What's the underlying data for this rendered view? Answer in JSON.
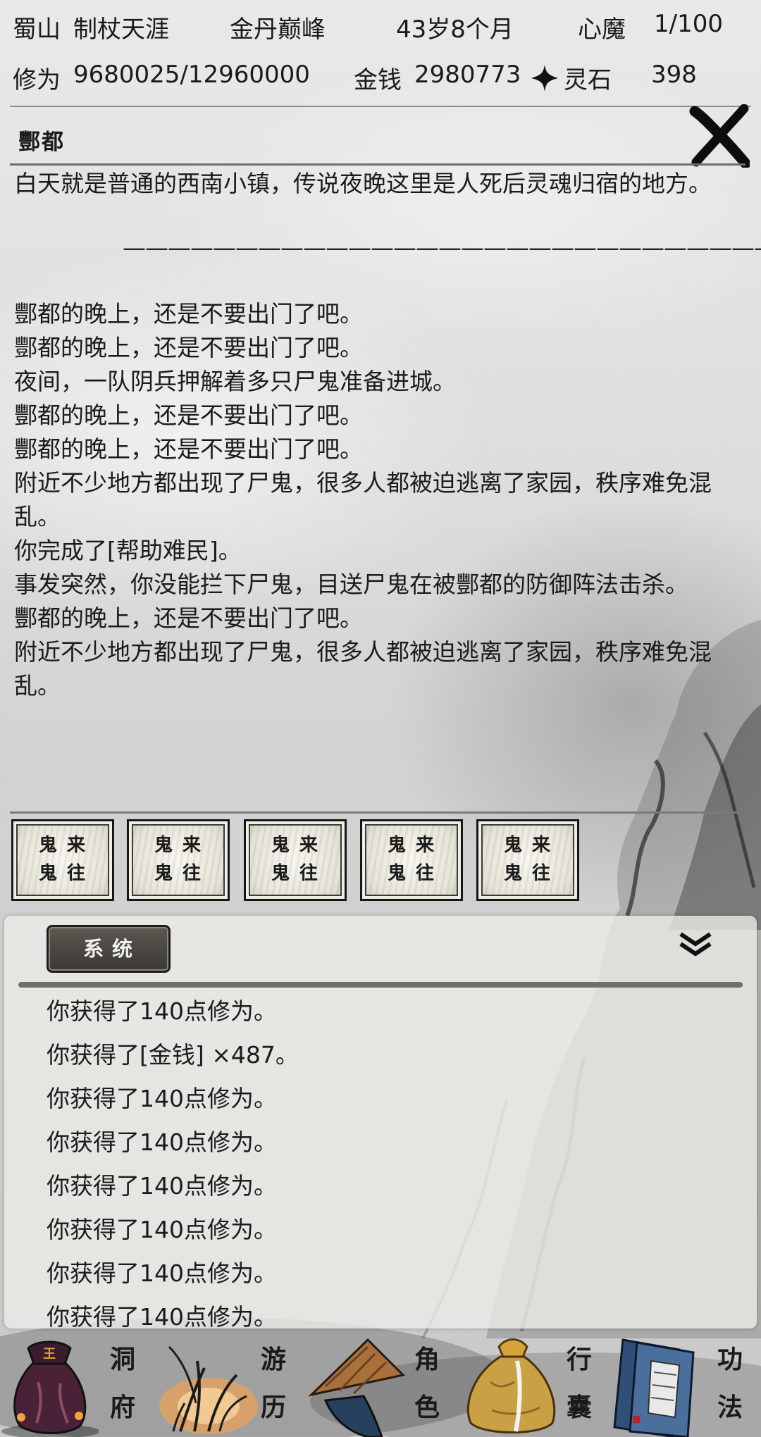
{
  "status": {
    "sect": "蜀山",
    "title": "制杖天涯",
    "realm": "金丹巅峰",
    "age": "43岁8个月",
    "heart_demon_label": "心魔",
    "heart_demon_value": "1/100",
    "cultivation_label": "修为",
    "cultivation_value": "9680025/12960000",
    "money_label": "金钱",
    "money_value": "2980773",
    "spirit_stone_label": "灵石",
    "spirit_stone_value": "398"
  },
  "location": {
    "name": "酆都",
    "description": "白天就是普通的西南小镇，传说夜晚这里是人死后灵魂归宿的地方。",
    "separator": "——————————————————————————————",
    "events": [
      "酆都的晚上，还是不要出门了吧。",
      "酆都的晚上，还是不要出门了吧。",
      "夜间，一队阴兵押解着多只尸鬼准备进城。",
      "酆都的晚上，还是不要出门了吧。",
      "酆都的晚上，还是不要出门了吧。",
      "附近不少地方都出现了尸鬼，很多人都被迫逃离了家园，秩序难免混乱。",
      "你完成了[帮助难民]。",
      "事发突然，你没能拦下尸鬼，目送尸鬼在被酆都的防御阵法击杀。",
      "酆都的晚上，还是不要出门了吧。",
      "附近不少地方都出现了尸鬼，很多人都被迫逃离了家园，秩序难免混乱。"
    ]
  },
  "actions": [
    {
      "line1": "鬼来",
      "line2": "鬼往"
    },
    {
      "line1": "鬼来",
      "line2": "鬼往"
    },
    {
      "line1": "鬼来",
      "line2": "鬼往"
    },
    {
      "line1": "鬼来",
      "line2": "鬼往"
    },
    {
      "line1": "鬼来",
      "line2": "鬼往"
    }
  ],
  "log": {
    "tab_label": "系统",
    "lines": [
      "你获得了140点修为。",
      "你获得了[金钱] ×487。",
      "你获得了140点修为。",
      "你获得了140点修为。",
      "你获得了140点修为。",
      "你获得了140点修为。",
      "你获得了140点修为。",
      "你获得了140点修为。"
    ]
  },
  "nav": {
    "cave": {
      "c1": "洞",
      "c2": "府",
      "icon": "treasure-bag-icon"
    },
    "travel": {
      "c1": "游",
      "c2": "历",
      "icon": "grass-icon"
    },
    "character": {
      "c1": "角",
      "c2": "色",
      "icon": "straw-hat-icon"
    },
    "inventory": {
      "c1": "行",
      "c2": "囊",
      "icon": "cloth-sack-icon"
    },
    "skills": {
      "c1": "功",
      "c2": "法",
      "icon": "books-icon"
    }
  },
  "colors": {
    "ink": "#1b1b1b",
    "tab_bg": "#4a4743",
    "panel_bg": "#ecece8",
    "travel_glow": "#e9a15a"
  }
}
